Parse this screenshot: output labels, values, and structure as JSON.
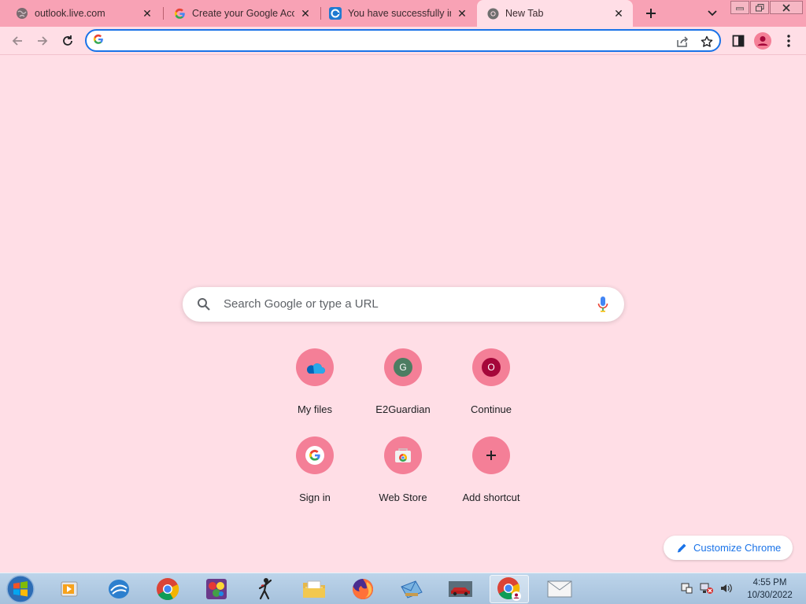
{
  "tabs": [
    {
      "title": "outlook.live.com",
      "favicon": "globe-icon"
    },
    {
      "title": "Create your Google Accou",
      "favicon": "google-g-icon"
    },
    {
      "title": "You have successfully inst",
      "favicon": "edge-icon"
    },
    {
      "title": "New Tab",
      "favicon": "chrome-icon",
      "active": true
    }
  ],
  "toolbar": {
    "omnibox_value": "",
    "omnibox_placeholder": ""
  },
  "search": {
    "placeholder": "Search Google or type a URL"
  },
  "shortcuts": [
    {
      "label": "My files",
      "icon": "onedrive-icon"
    },
    {
      "label": "E2Guardian",
      "icon": "letter-g-icon",
      "letter": "G"
    },
    {
      "label": "Continue",
      "icon": "letter-o-icon",
      "letter": "O"
    },
    {
      "label": "Sign in",
      "icon": "google-g-icon"
    },
    {
      "label": "Web Store",
      "icon": "webstore-icon"
    },
    {
      "label": "Add shortcut",
      "icon": "plus-icon"
    }
  ],
  "customize": {
    "label": "Customize Chrome"
  },
  "taskbar": {
    "time": "4:55 PM",
    "date": "10/30/2022",
    "apps": [
      "windows-media-player-icon",
      "openoffice-icon",
      "chrome-icon",
      "game-icon",
      "stickman-icon",
      "file-explorer-icon",
      "firefox-icon",
      "mail-app-icon",
      "car-game-icon",
      "chrome-user-icon",
      "mail-envelope-icon"
    ]
  },
  "colors": {
    "accent": "#1a73e8",
    "tabstrip": "#f8a2b5",
    "page_bg": "#ffdee6",
    "shortcut_bg": "#f47f97"
  }
}
